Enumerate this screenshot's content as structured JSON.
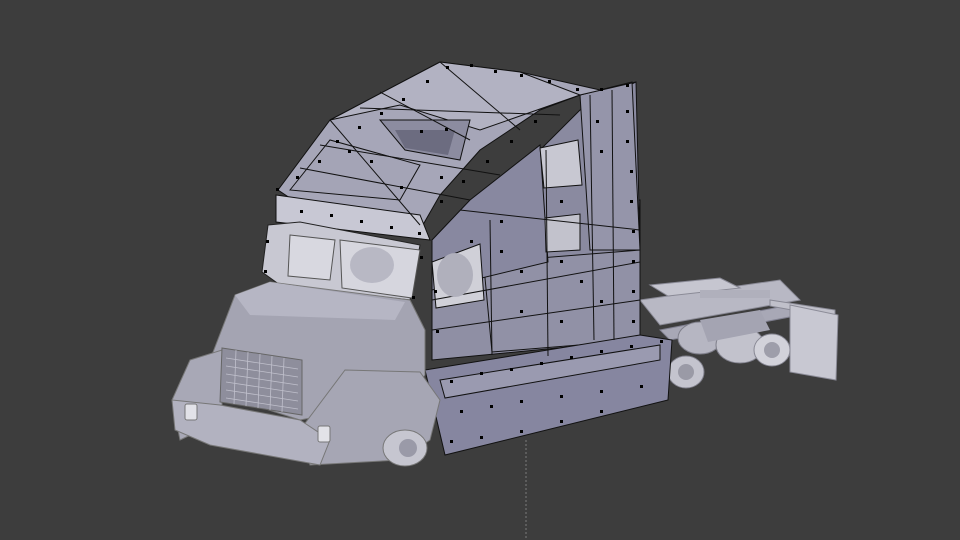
{
  "viewport": {
    "background": "#3d3d3d",
    "mesh_fill": "#9c9cb0",
    "mesh_fill_light": "#b4b4c6",
    "mesh_fill_dark": "#7c7c8e",
    "edge_color": "#0e0e10",
    "vertex_color": "#000000",
    "axis_line_color": "#7a7a7a"
  },
  "scene": {
    "object": "truck-cab-mesh",
    "mode": "edit-mode-vertex-select"
  }
}
